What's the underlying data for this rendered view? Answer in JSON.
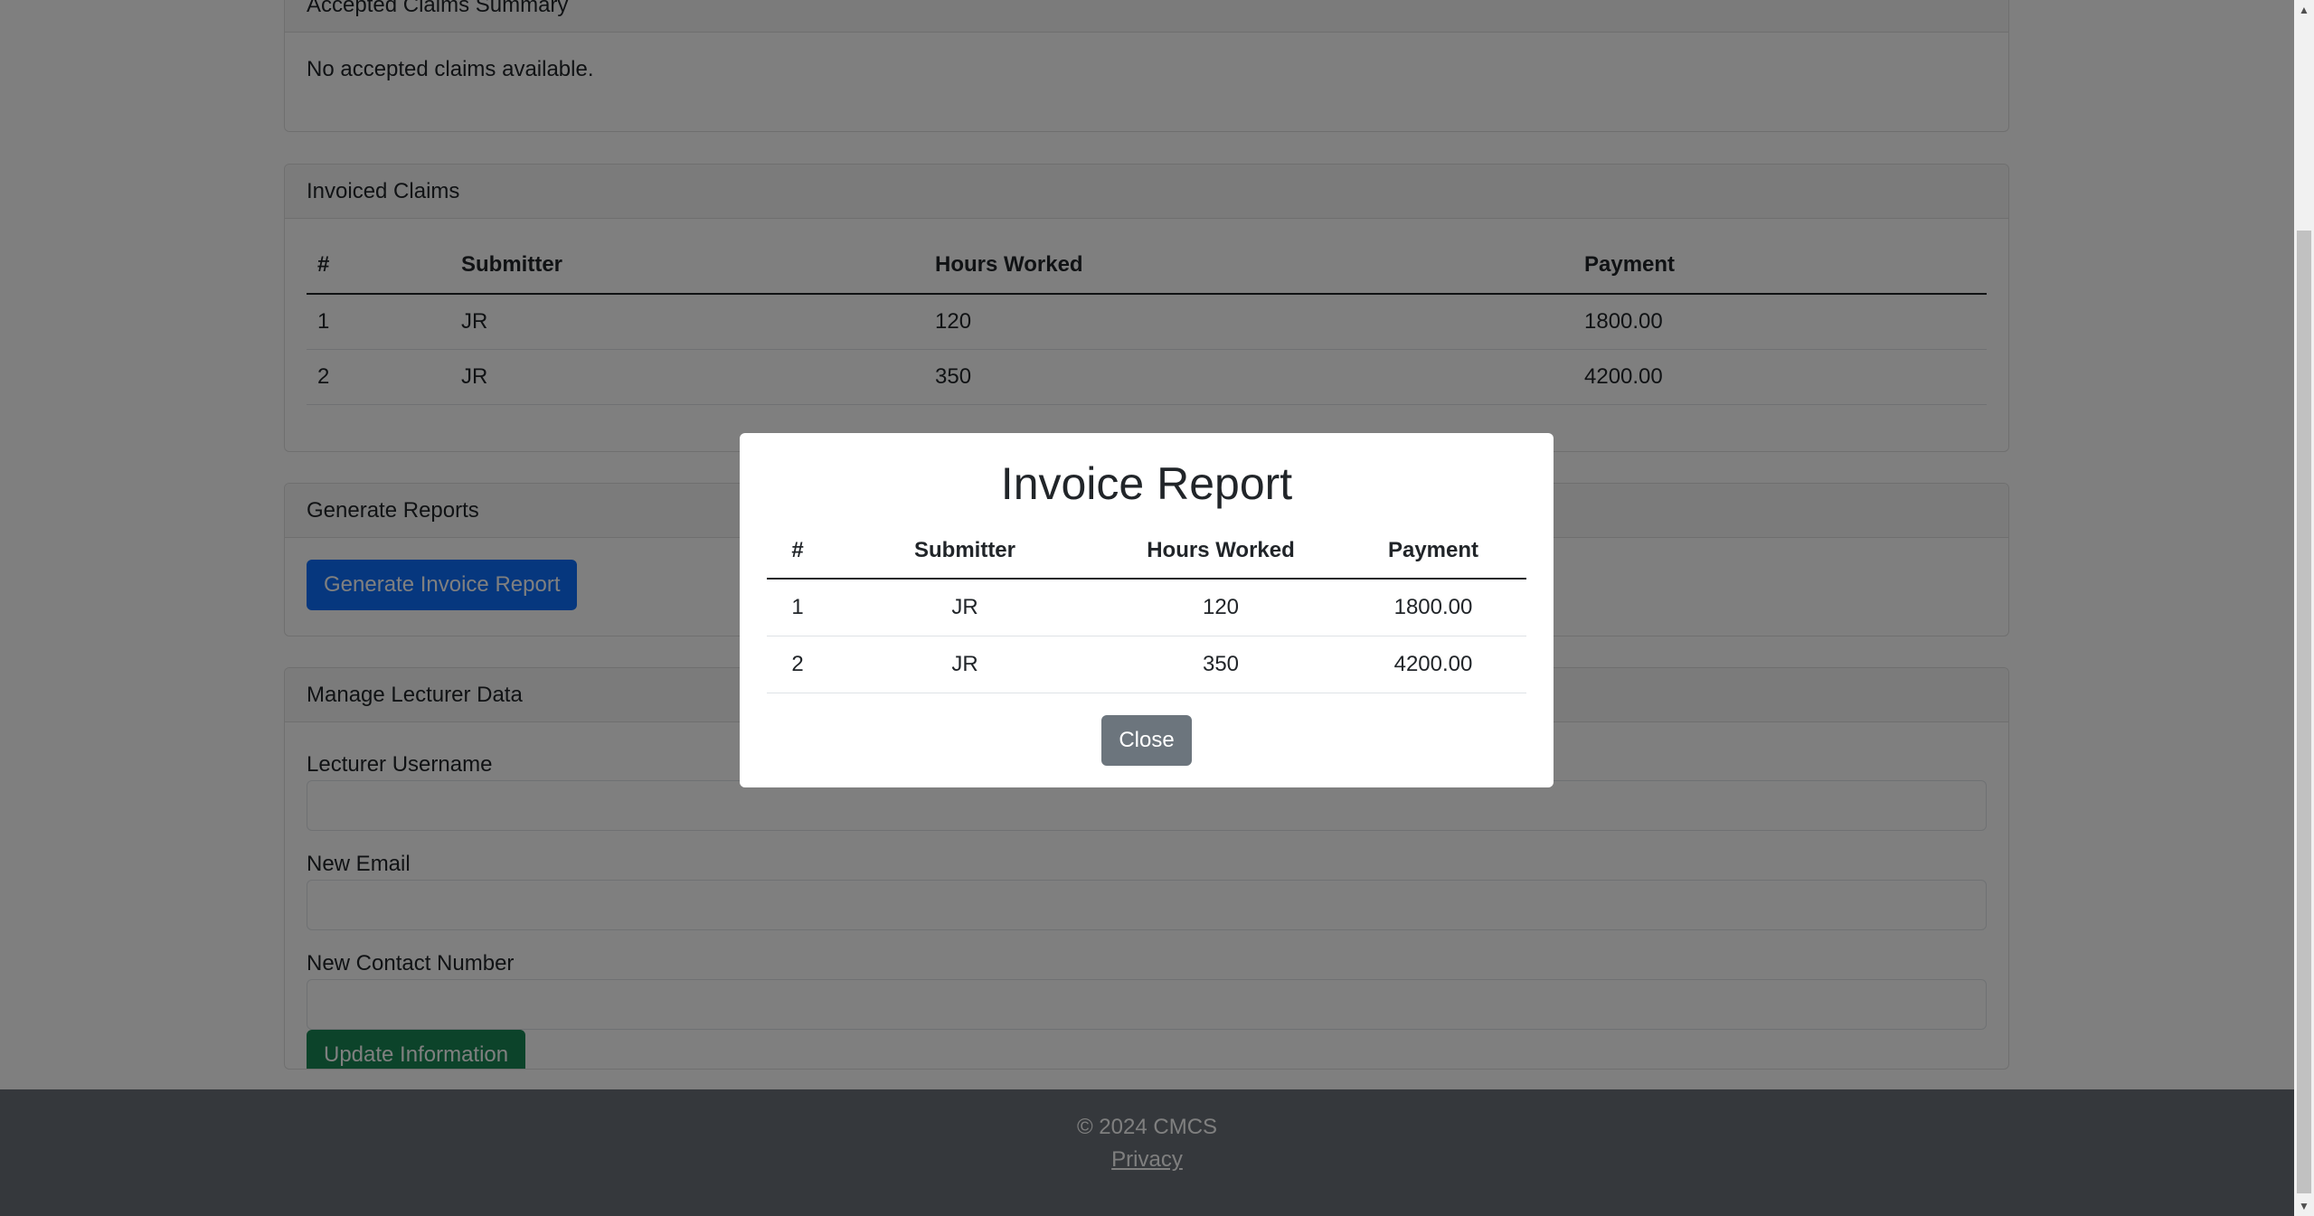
{
  "accepted": {
    "title": "Accepted Claims Summary",
    "empty_text": "No accepted claims available."
  },
  "invoiced": {
    "title": "Invoiced Claims",
    "columns": [
      "#",
      "Submitter",
      "Hours Worked",
      "Payment"
    ],
    "rows": [
      [
        "1",
        "JR",
        "120",
        "1800.00"
      ],
      [
        "2",
        "JR",
        "350",
        "4200.00"
      ]
    ]
  },
  "reports": {
    "title": "Generate Reports",
    "button_label": "Generate Invoice Report"
  },
  "lecturer": {
    "title": "Manage Lecturer Data",
    "username_label": "Lecturer Username",
    "email_label": "New Email",
    "contact_label": "New Contact Number",
    "username_value": "",
    "email_value": "",
    "contact_value": "",
    "update_label": "Update Information"
  },
  "footer": {
    "copyright": "© 2024 CMCS",
    "privacy_link": "Privacy"
  },
  "modal": {
    "title": "Invoice Report",
    "columns": [
      "#",
      "Submitter",
      "Hours Worked",
      "Payment"
    ],
    "rows": [
      [
        "1",
        "JR",
        "120",
        "1800.00"
      ],
      [
        "2",
        "JR",
        "350",
        "4200.00"
      ]
    ],
    "close_label": "Close"
  },
  "scrollbar": {
    "up_glyph": "▲",
    "down_glyph": "▼"
  },
  "colors": {
    "primary": "#0d6efd",
    "success": "#198754",
    "secondary": "#6c757d",
    "footer_bg": "#343a40",
    "overlay": "rgba(0,0,0,0.5)"
  }
}
